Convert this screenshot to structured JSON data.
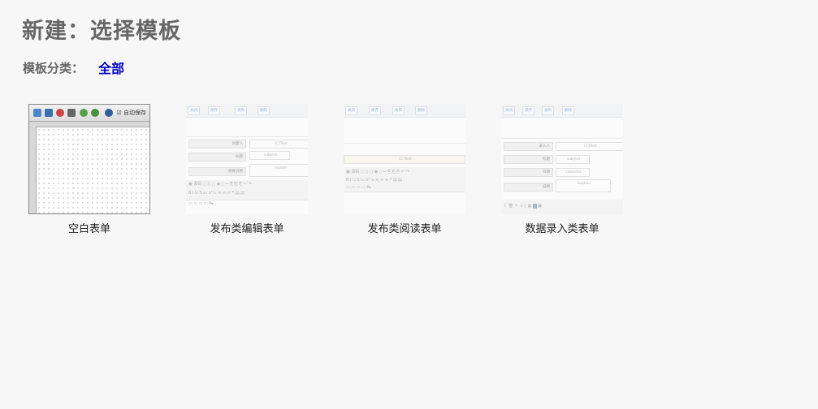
{
  "page": {
    "title": "新建：选择模板"
  },
  "category": {
    "label": "模板分类：",
    "current": "全部"
  },
  "templates": [
    {
      "caption": "空白表单",
      "preview": {
        "toolbar_text": "自动保存"
      }
    },
    {
      "caption": "发布类编辑表单",
      "preview": {
        "buttons": [
          "关闭",
          "保存",
          "发布",
          "删除"
        ],
        "labels": [
          "创建人",
          "标题",
          "摘要说明"
        ],
        "fields": [
          "[C]Text",
          "subject",
          "explain"
        ],
        "editor_first_btn": "源码"
      }
    },
    {
      "caption": "发布类阅读表单",
      "preview": {
        "buttons": [
          "关闭",
          "保存",
          "发布",
          "删除"
        ],
        "field": "[C]Text",
        "editor_first_btn": "源码"
      }
    },
    {
      "caption": "数据录入类表单",
      "preview": {
        "buttons": [
          "关闭",
          "保存",
          "发布",
          "删除"
        ],
        "labels": [
          "录入人",
          "标题",
          "日期",
          "说明"
        ],
        "fields": [
          "[C]Text",
          "subject",
          "calendar",
          "explain"
        ]
      }
    }
  ]
}
